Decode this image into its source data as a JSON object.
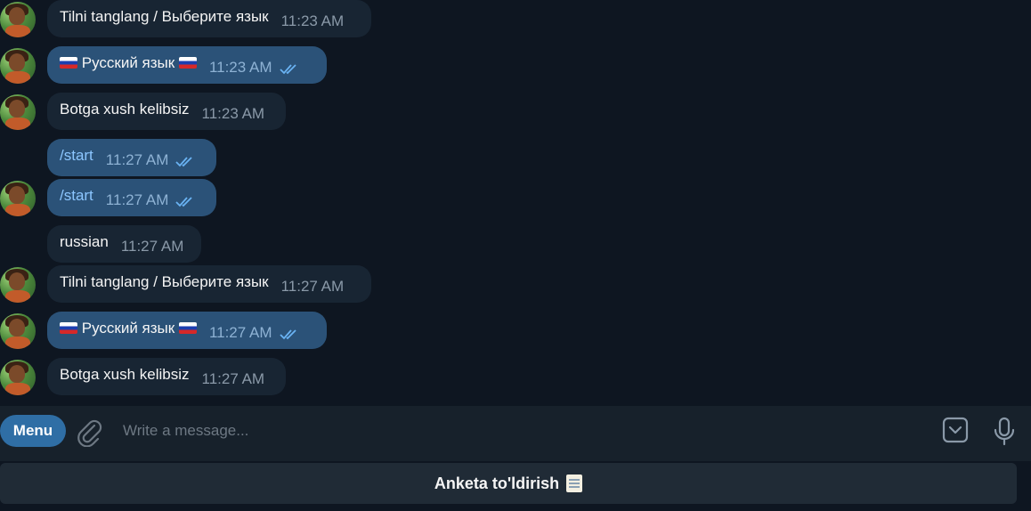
{
  "messages": [
    {
      "dir": "in",
      "text": "Tilni tanglang / Выберите язык",
      "time": "11:23 AM",
      "avatar": true
    },
    {
      "dir": "out",
      "text": "Русский язык",
      "flags": true,
      "time": "11:23 AM",
      "avatar": true
    },
    {
      "dir": "in",
      "text": "Botga xush kelibsiz",
      "time": "11:23 AM",
      "avatar": true
    },
    {
      "dir": "out",
      "text": "/start",
      "command": true,
      "time": "11:27 AM",
      "avatar": false
    },
    {
      "dir": "out",
      "text": "/start",
      "command": true,
      "time": "11:27 AM",
      "avatar": true
    },
    {
      "dir": "in",
      "text": "russian",
      "time": "11:27 AM",
      "avatar": false
    },
    {
      "dir": "in",
      "text": "Tilni tanglang / Выберите язык",
      "time": "11:27 AM",
      "avatar": true
    },
    {
      "dir": "out",
      "text": "Русский язык",
      "flags": true,
      "time": "11:27 AM",
      "avatar": true
    },
    {
      "dir": "in",
      "text": "Botga xush kelibsiz",
      "time": "11:27 AM",
      "avatar": true
    }
  ],
  "composer": {
    "menu_label": "Menu",
    "placeholder": "Write a message..."
  },
  "keyboard": {
    "button_label": "Anketa to'ldirish"
  },
  "icons": {
    "attach": "paperclip-icon",
    "bot_keyboard": "keyboard-toggle-icon",
    "mic": "microphone-icon",
    "read": "double-check-icon",
    "memo": "memo-emoji-icon",
    "flag": "russian-flag-icon"
  },
  "colors": {
    "background": "#0e1621",
    "incoming_bubble": "#182533",
    "outgoing_bubble": "#2b5278",
    "menu_button": "#2f6ea5",
    "command_text": "#8cc6ff"
  }
}
